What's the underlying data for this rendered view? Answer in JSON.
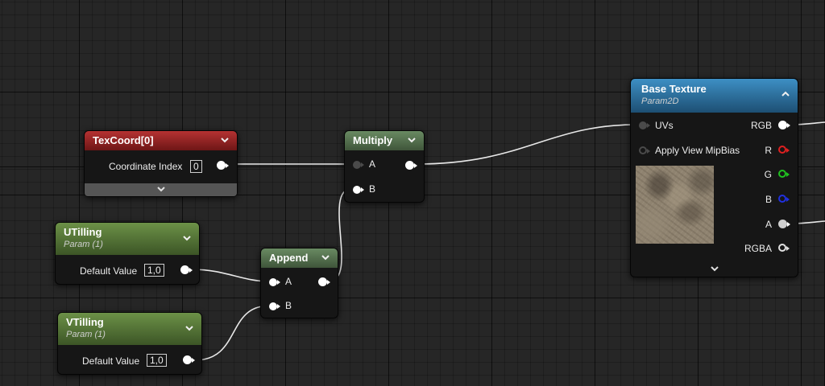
{
  "nodes": {
    "texcoord": {
      "title": "TexCoord[0]",
      "field_label": "Coordinate Index",
      "field_value": "0"
    },
    "multiply": {
      "title": "Multiply",
      "input_a": "A",
      "input_b": "B"
    },
    "utilling": {
      "title": "UTilling",
      "subtitle": "Param (1)",
      "field_label": "Default Value",
      "field_value": "1,0"
    },
    "vtilling": {
      "title": "VTilling",
      "subtitle": "Param (1)",
      "field_label": "Default Value",
      "field_value": "1,0"
    },
    "append": {
      "title": "Append",
      "input_a": "A",
      "input_b": "B"
    },
    "base_texture": {
      "title": "Base Texture",
      "subtitle": "Param2D",
      "inputs": [
        "UVs",
        "Apply View MipBias"
      ],
      "outputs": [
        "RGB",
        "R",
        "G",
        "B",
        "A",
        "RGBA"
      ]
    }
  },
  "colors": {
    "grid_background": "#262626",
    "wire": "#e8e8e8",
    "header_texcoord": "#a02a2a",
    "header_param": "#5d7f3c",
    "header_math": "#5a7753",
    "header_texture": "#2f7bb0",
    "pin_r": "#e02020",
    "pin_g": "#20c020",
    "pin_b": "#2030e0"
  },
  "icons": [
    "chevron-down-icon",
    "chevron-up-icon"
  ]
}
